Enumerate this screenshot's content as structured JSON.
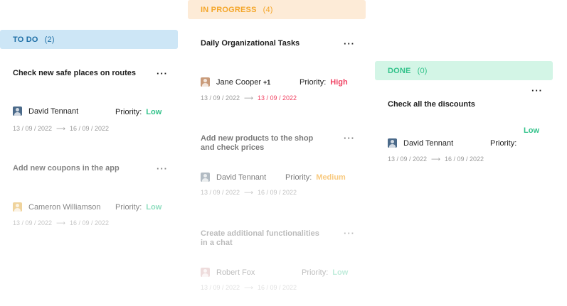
{
  "columns": {
    "todo": {
      "label": "TO DO",
      "count": "(2)",
      "color": "#1e6fa6",
      "bg": "#cde6f6"
    },
    "progress": {
      "label": "IN PROGRESS",
      "count": "(4)",
      "color": "#f4a62a",
      "bg": "#fdebd7"
    },
    "done": {
      "label": "DONE",
      "count": "(0)",
      "color": "#32c28a",
      "bg": "#d3f5e6"
    }
  },
  "priority_label": "Priority:",
  "more_label": "···",
  "arrow": "⟶",
  "cards": {
    "todo1": {
      "title": "Check new safe places on routes",
      "assignee": "David Tennant",
      "priority": "Low",
      "start": "13 / 09 / 2022",
      "end": "16 / 09 / 2022"
    },
    "todo2": {
      "title": "Add new coupons in the app",
      "assignee": "Cameron Williamson",
      "priority": "Low",
      "start": "13 / 09 / 2022",
      "end": "16 / 09 / 2022"
    },
    "prog1": {
      "title": "Daily Organizational Tasks",
      "assignee": "Jane Cooper",
      "extra": "+1",
      "priority": "High",
      "start": "13 / 09  / 2022",
      "end": "13 / 09 / 2022"
    },
    "prog2": {
      "title_line1": "Add new products to the shop",
      "title_line2": "and check prices",
      "assignee": "David Tennant",
      "priority": "Medium",
      "start": "13 / 09 / 2022",
      "end": "16 / 09 / 2022"
    },
    "prog3": {
      "title_line1": "Create additional functionalities",
      "title_line2": "in a chat",
      "assignee": "Robert Fox",
      "priority": "Low",
      "start": "13 / 09 / 2022",
      "end": "16 / 09 / 2022"
    },
    "done1": {
      "title": "Check all the discounts",
      "assignee": "David Tennant",
      "priority": "Low",
      "start": "13 / 09 / 2022",
      "end": "16 / 09 / 2022"
    }
  },
  "colors": {
    "low": "#32c28a",
    "high": "#f04464",
    "medium": "#f4a62a"
  },
  "icons": {
    "more": "more-dots-icon",
    "avatar": "avatar-icon"
  }
}
